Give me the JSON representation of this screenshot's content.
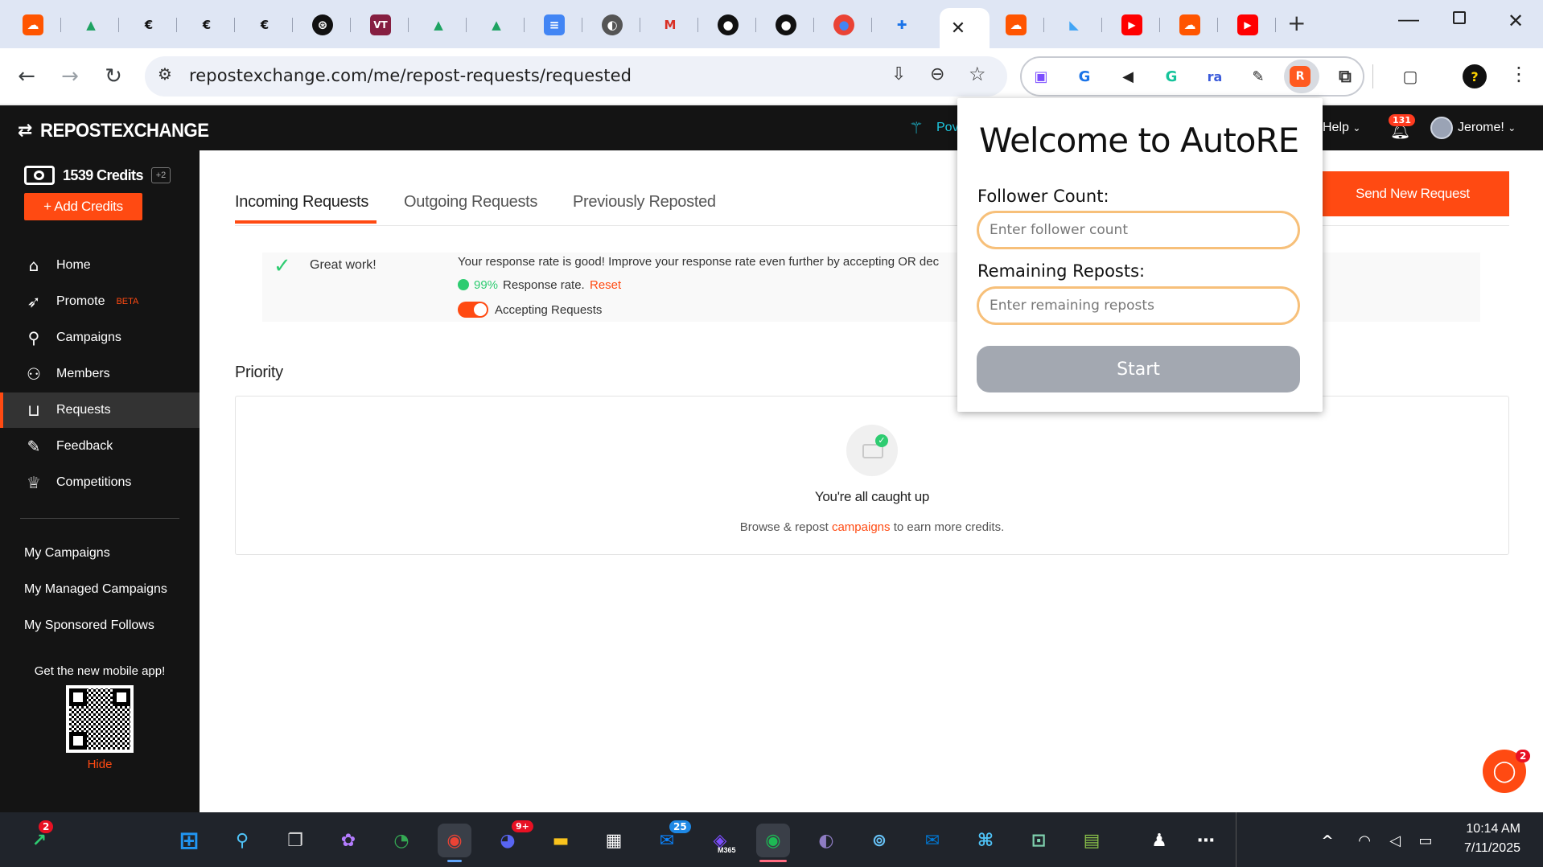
{
  "browser": {
    "url": "repostexchange.com/me/repost-requests/requested"
  },
  "site": {
    "logo": "REPOSTEXCHANGE",
    "header_partial": "Pov",
    "help": "Help",
    "notifications_count": "131",
    "user": "Jerome!"
  },
  "sidebar": {
    "credits": "1539 Credits",
    "credits_delta": "+2",
    "add_credits": "+ Add Credits",
    "nav": [
      {
        "label": "Home",
        "icon": "home-icon"
      },
      {
        "label": "Promote",
        "badge": "BETA",
        "icon": "rocket-icon"
      },
      {
        "label": "Campaigns",
        "icon": "search-icon"
      },
      {
        "label": "Members",
        "icon": "members-icon"
      },
      {
        "label": "Requests",
        "icon": "inbox-icon"
      },
      {
        "label": "Feedback",
        "icon": "pencil-icon"
      },
      {
        "label": "Competitions",
        "icon": "trophy-icon"
      }
    ],
    "links": [
      "My Campaigns",
      "My Managed Campaigns",
      "My Sponsored Follows"
    ],
    "mobile_app": "Get the new mobile app!",
    "hide": "Hide"
  },
  "main": {
    "tabs": [
      "Incoming Requests",
      "Outgoing Requests",
      "Previously Reposted"
    ],
    "send_new_request": "Send New Request",
    "banner": {
      "title": "Great work!",
      "message": "Your response rate is good! Improve your response rate even further by accepting OR dec",
      "rate": "99%",
      "rate_label": "Response rate.",
      "reset": "Reset",
      "toggle_label": "Accepting Requests"
    },
    "priority": "Priority",
    "empty": {
      "title": "You're all caught up",
      "prefix": "Browse & repost",
      "link": "campaigns",
      "suffix": "to earn more credits."
    },
    "chat_badge": "2"
  },
  "popup": {
    "title": "Welcome to AutoRE",
    "follower_label": "Follower Count:",
    "follower_placeholder": "Enter follower count",
    "reposts_label": "Remaining Reposts:",
    "reposts_placeholder": "Enter remaining reposts",
    "start": "Start"
  },
  "taskbar": {
    "stocks_badge": "2",
    "discord_badge": "9+",
    "mail_badge": "25",
    "m365_label": "M365",
    "time": "10:14 AM",
    "date": "7/11/2025"
  },
  "colors": {
    "accent": "#ff4a12",
    "dark": "#141414",
    "popup_border": "#f7c07a",
    "start_button": "#a3a8b1",
    "success": "#2ecc71"
  }
}
